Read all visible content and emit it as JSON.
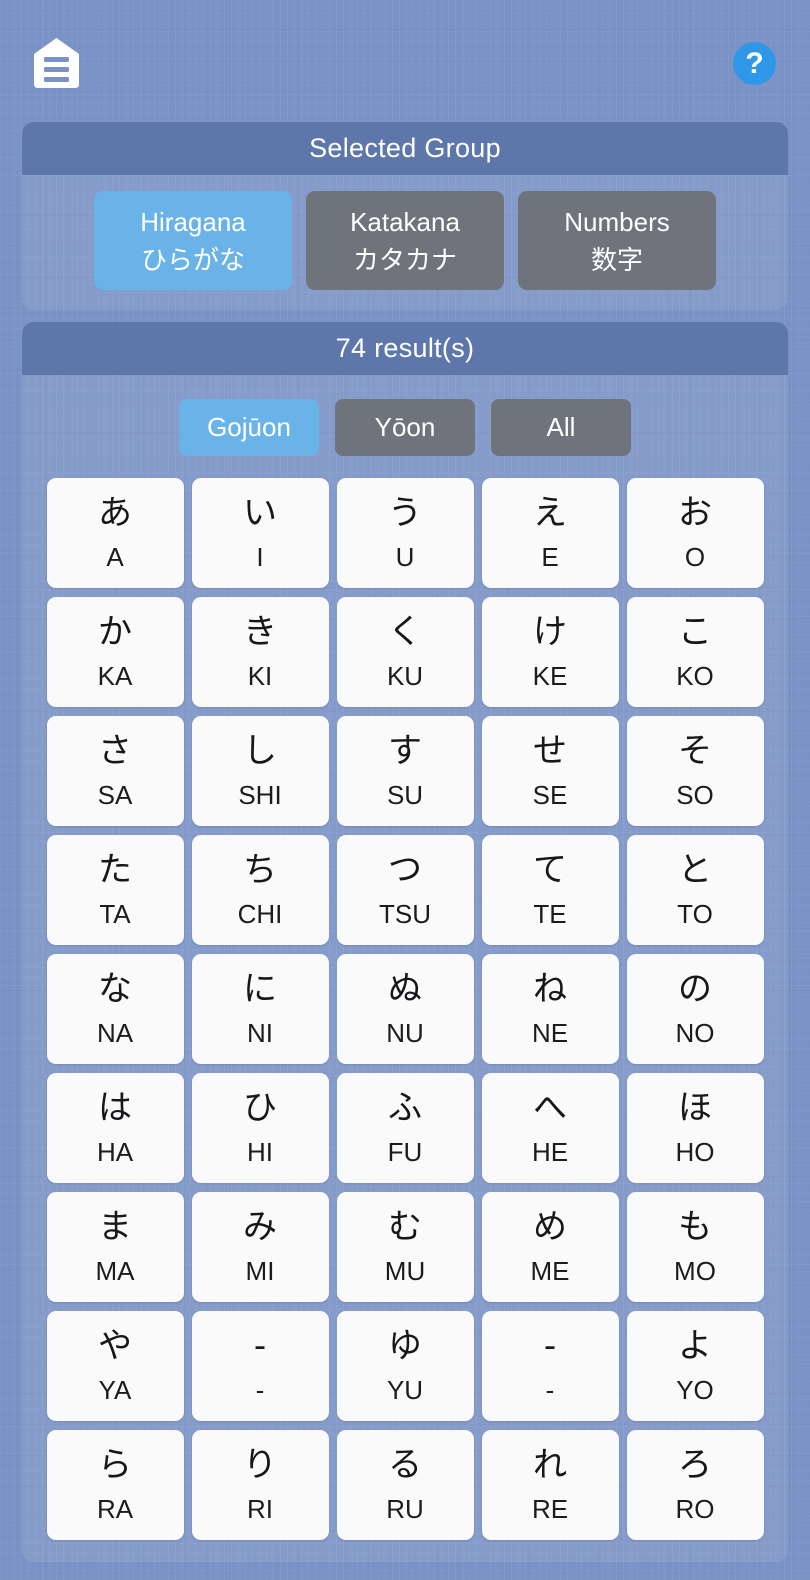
{
  "topbar": {
    "home_icon": "home-menu-icon",
    "help_icon": "help-question-icon",
    "help_label": "?"
  },
  "selected_group": {
    "title": "Selected Group",
    "options": [
      {
        "romaji": "Hiragana",
        "kana": "ひらがな",
        "selected": true
      },
      {
        "romaji": "Katakana",
        "kana": "カタカナ",
        "selected": false
      },
      {
        "romaji": "Numbers",
        "kana": "数字",
        "selected": false
      }
    ]
  },
  "results": {
    "count_label": "74 result(s)",
    "filters": [
      {
        "label": "Gojūon",
        "selected": true
      },
      {
        "label": "Yōon",
        "selected": false
      },
      {
        "label": "All",
        "selected": false
      }
    ]
  },
  "kana_grid": [
    {
      "glyph": "あ",
      "roman": "A"
    },
    {
      "glyph": "い",
      "roman": "I"
    },
    {
      "glyph": "う",
      "roman": "U"
    },
    {
      "glyph": "え",
      "roman": "E"
    },
    {
      "glyph": "お",
      "roman": "O"
    },
    {
      "glyph": "か",
      "roman": "KA"
    },
    {
      "glyph": "き",
      "roman": "KI"
    },
    {
      "glyph": "く",
      "roman": "KU"
    },
    {
      "glyph": "け",
      "roman": "KE"
    },
    {
      "glyph": "こ",
      "roman": "KO"
    },
    {
      "glyph": "さ",
      "roman": "SA"
    },
    {
      "glyph": "し",
      "roman": "SHI"
    },
    {
      "glyph": "す",
      "roman": "SU"
    },
    {
      "glyph": "せ",
      "roman": "SE"
    },
    {
      "glyph": "そ",
      "roman": "SO"
    },
    {
      "glyph": "た",
      "roman": "TA"
    },
    {
      "glyph": "ち",
      "roman": "CHI"
    },
    {
      "glyph": "つ",
      "roman": "TSU"
    },
    {
      "glyph": "て",
      "roman": "TE"
    },
    {
      "glyph": "と",
      "roman": "TO"
    },
    {
      "glyph": "な",
      "roman": "NA"
    },
    {
      "glyph": "に",
      "roman": "NI"
    },
    {
      "glyph": "ぬ",
      "roman": "NU"
    },
    {
      "glyph": "ね",
      "roman": "NE"
    },
    {
      "glyph": "の",
      "roman": "NO"
    },
    {
      "glyph": "は",
      "roman": "HA"
    },
    {
      "glyph": "ひ",
      "roman": "HI"
    },
    {
      "glyph": "ふ",
      "roman": "FU"
    },
    {
      "glyph": "へ",
      "roman": "HE"
    },
    {
      "glyph": "ほ",
      "roman": "HO"
    },
    {
      "glyph": "ま",
      "roman": "MA"
    },
    {
      "glyph": "み",
      "roman": "MI"
    },
    {
      "glyph": "む",
      "roman": "MU"
    },
    {
      "glyph": "め",
      "roman": "ME"
    },
    {
      "glyph": "も",
      "roman": "MO"
    },
    {
      "glyph": "や",
      "roman": "YA"
    },
    {
      "glyph": "-",
      "roman": "-"
    },
    {
      "glyph": "ゆ",
      "roman": "YU"
    },
    {
      "glyph": "-",
      "roman": "-"
    },
    {
      "glyph": "よ",
      "roman": "YO"
    },
    {
      "glyph": "ら",
      "roman": "RA"
    },
    {
      "glyph": "り",
      "roman": "RI"
    },
    {
      "glyph": "る",
      "roman": "RU"
    },
    {
      "glyph": "れ",
      "roman": "RE"
    },
    {
      "glyph": "ろ",
      "roman": "RO"
    }
  ],
  "colors": {
    "background": "#7a92c6",
    "panel_header": "#5d77ab",
    "selected_accent": "#6ab3e8",
    "unselected_button": "#6f747c",
    "card_background": "#fafafa",
    "help_icon": "#2f97e8"
  }
}
